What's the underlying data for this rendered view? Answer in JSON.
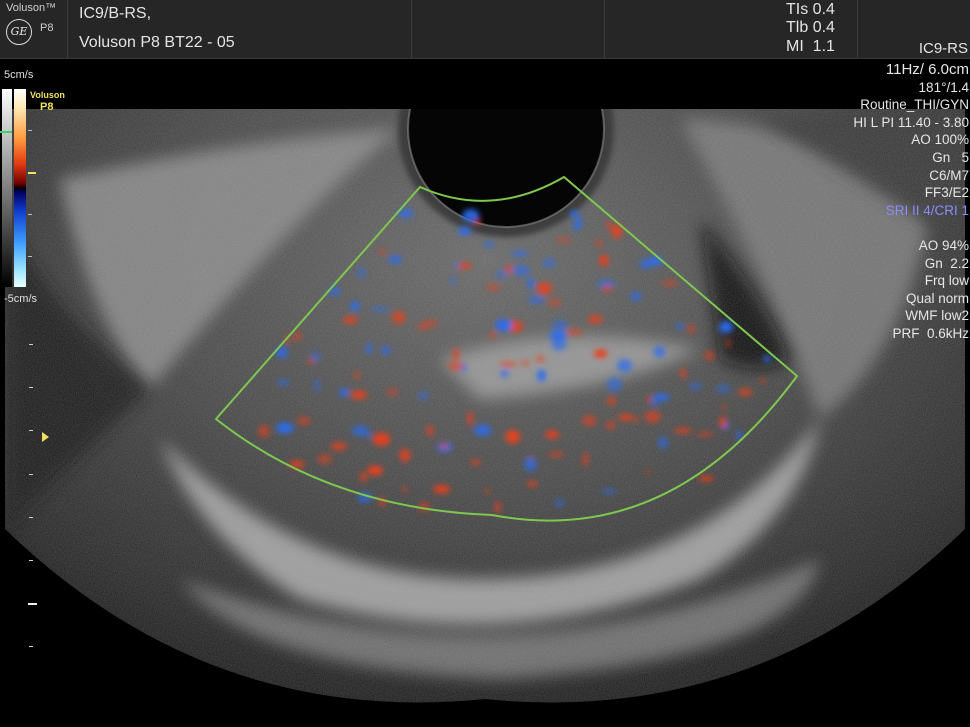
{
  "header": {
    "brand": "Voluson™",
    "logo_text": "GE",
    "model": "P8",
    "probe_preset": "IC9/B-RS,",
    "system_name": "Voluson P8 BT22 - 05",
    "indices": [
      {
        "label": "TIs",
        "value": "0.4"
      },
      {
        "label": "Tlb",
        "value": "0.4"
      },
      {
        "label": "MI",
        "value": "1.1"
      }
    ],
    "probe": "IC9-RS"
  },
  "color_scale": {
    "max_label": "5cm/s",
    "min_label": "-5cm/s",
    "brand": "Voluson",
    "model": "P8"
  },
  "parameters": {
    "bmode": [
      "11Hz/ 6.0cm",
      "181°/1.4",
      "Routine_THI/GYN",
      "HI L PI 11.40 - 3.80",
      "AO 100%",
      "Gn   5",
      "C6/M7",
      "FF3/E2"
    ],
    "highlight": "SRI II 4/CRI 1",
    "color": [
      "AO 94%",
      "Gn  2.2",
      "Frq low",
      "Qual norm",
      "WMF low2",
      "PRF  0.6kHz"
    ]
  },
  "colors": {
    "roi_outline": "#7ec850",
    "highlight_text": "#8a8cff",
    "marker_yellow": "#f0e060",
    "doppler_red": "#e8401c",
    "doppler_blue": "#2a6cf0"
  }
}
